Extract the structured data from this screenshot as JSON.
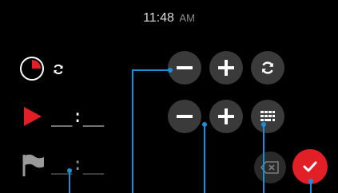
{
  "clock": {
    "time": "11:48",
    "ampm": "AM"
  },
  "rows": {
    "duration": {
      "icon": "pie-timer-icon",
      "secondary_icon": "refresh-icon"
    },
    "start": {
      "icon": "play-icon",
      "value": "__:__"
    },
    "finish": {
      "icon": "flag-icon",
      "value": "__:__"
    }
  },
  "controls": {
    "row1": [
      "minus-icon",
      "plus-icon",
      "refresh-icon"
    ],
    "row2": [
      "minus-icon",
      "plus-icon",
      "keypad-icon"
    ],
    "bottom": [
      "backspace-icon",
      "confirm-check-icon"
    ]
  },
  "colors": {
    "background": "#000000",
    "button_bg": "#3a3a3a",
    "accent_red": "#e21e26",
    "callout_blue": "#1c8fd8"
  }
}
